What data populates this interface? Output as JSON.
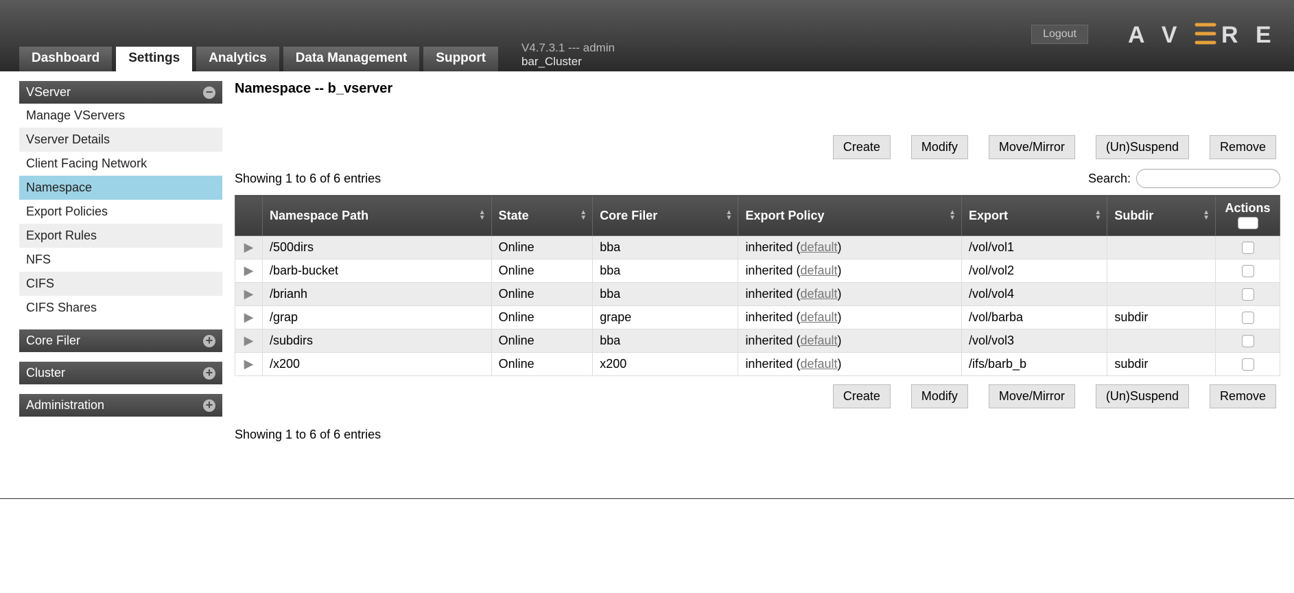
{
  "header": {
    "logout": "Logout",
    "version_line": "V4.7.3.1 --- admin",
    "cluster_name": "bar_Cluster",
    "tabs": [
      "Dashboard",
      "Settings",
      "Analytics",
      "Data Management",
      "Support"
    ],
    "active_tab_index": 1
  },
  "sidebar": {
    "sections": [
      {
        "title": "VServer",
        "state": "open",
        "items": [
          "Manage VServers",
          "Vserver Details",
          "Client Facing Network",
          "Namespace",
          "Export Policies",
          "Export Rules",
          "NFS",
          "CIFS",
          "CIFS Shares"
        ],
        "active_index": 3
      },
      {
        "title": "Core Filer",
        "state": "closed"
      },
      {
        "title": "Cluster",
        "state": "closed"
      },
      {
        "title": "Administration",
        "state": "closed"
      }
    ]
  },
  "page": {
    "title": "Namespace -- b_vserver",
    "showing_text": "Showing 1 to 6 of 6 entries",
    "search_label": "Search:",
    "buttons": [
      "Create",
      "Modify",
      "Move/Mirror",
      "(Un)Suspend",
      "Remove"
    ]
  },
  "table": {
    "columns": [
      "",
      "Namespace Path",
      "State",
      "Core Filer",
      "Export Policy",
      "Export",
      "Subdir",
      "Actions"
    ],
    "rows": [
      {
        "path": "/500dirs",
        "state": "Online",
        "filer": "bba",
        "policy_prefix": "inherited (",
        "policy_link": "default",
        "policy_suffix": ")",
        "export": "/vol/vol1",
        "subdir": ""
      },
      {
        "path": "/barb-bucket",
        "state": "Online",
        "filer": "bba",
        "policy_prefix": "inherited (",
        "policy_link": "default",
        "policy_suffix": ")",
        "export": "/vol/vol2",
        "subdir": ""
      },
      {
        "path": "/brianh",
        "state": "Online",
        "filer": "bba",
        "policy_prefix": "inherited (",
        "policy_link": "default",
        "policy_suffix": ")",
        "export": "/vol/vol4",
        "subdir": ""
      },
      {
        "path": "/grap",
        "state": "Online",
        "filer": "grape",
        "policy_prefix": "inherited (",
        "policy_link": "default",
        "policy_suffix": ")",
        "export": "/vol/barba",
        "subdir": "subdir"
      },
      {
        "path": "/subdirs",
        "state": "Online",
        "filer": "bba",
        "policy_prefix": "inherited (",
        "policy_link": "default",
        "policy_suffix": ")",
        "export": "/vol/vol3",
        "subdir": ""
      },
      {
        "path": "/x200",
        "state": "Online",
        "filer": "x200",
        "policy_prefix": "inherited (",
        "policy_link": "default",
        "policy_suffix": ")",
        "export": "/ifs/barb_b",
        "subdir": "subdir"
      }
    ]
  }
}
